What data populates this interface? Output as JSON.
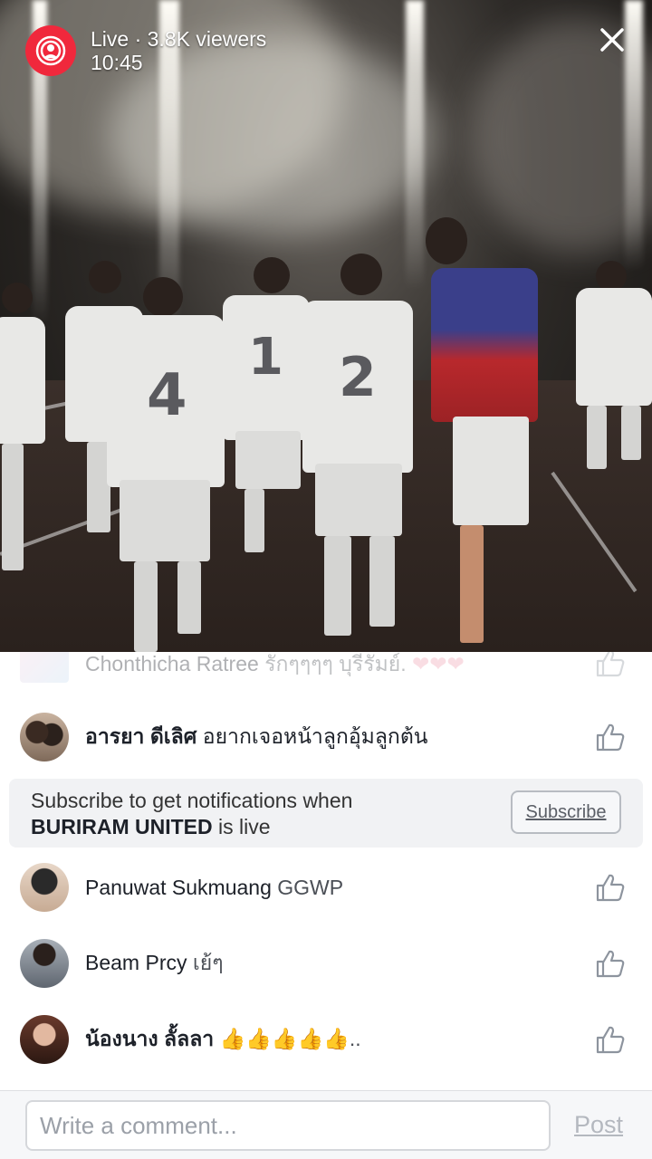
{
  "live": {
    "status_label": "Live · 3.8K viewers",
    "duration": "10:45"
  },
  "comments": [
    {
      "name": "Chonthicha Ratree",
      "message": "รักๆๆๆๆ บุรีรัมย์.",
      "emoji": "❤❤❤",
      "faded": true
    },
    {
      "name": "อารยา ดีเลิศ",
      "message": "อยากเจอหน้าลูกอุ้มลูกต้น"
    },
    {
      "name": "Panuwat Sukmuang",
      "message": "GGWP"
    },
    {
      "name": "Beam Prcy",
      "message": "เย้ๆ"
    },
    {
      "name": "น้องนาง ลั้ลลา",
      "message": "👍👍👍👍👍.."
    }
  ],
  "subscribe": {
    "text_prefix": "Subscribe to get notifications when",
    "page_name": "BURIRAM UNITED",
    "text_suffix": "is live",
    "button_label": "Subscribe"
  },
  "composer": {
    "placeholder": "Write a comment...",
    "post_label": "Post"
  },
  "colors": {
    "live_red": "#f0283c",
    "text_dark": "#1d2129",
    "muted": "#9ba0a8"
  },
  "icons": {
    "live": "broadcast-person-icon",
    "close": "close-x-icon",
    "like": "thumbs-up-outline-icon"
  }
}
